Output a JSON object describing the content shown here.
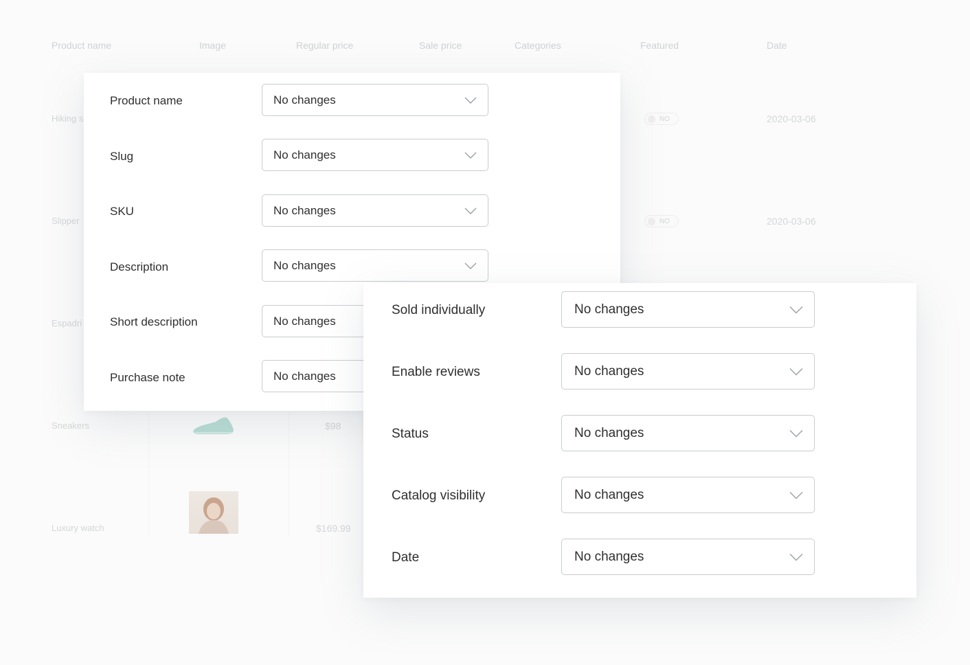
{
  "background_table": {
    "headers": [
      "Product name",
      "Image",
      "Regular price",
      "Sale price",
      "Categories",
      "Featured",
      "Date"
    ],
    "rows": [
      {
        "name": "Hiking s",
        "featured": "NO",
        "date": "2020-03-06"
      },
      {
        "name": "Slipper",
        "featured": "NO",
        "date": "2020-03-06"
      },
      {
        "name": "Espadri"
      },
      {
        "name": "Sneakers",
        "price": "$98"
      },
      {
        "name": "Luxury watch",
        "price": "$169.99"
      }
    ]
  },
  "panel_a": {
    "fields": [
      {
        "label": "Product name",
        "value": "No changes"
      },
      {
        "label": "Slug",
        "value": "No changes"
      },
      {
        "label": "SKU",
        "value": "No changes"
      },
      {
        "label": "Description",
        "value": "No changes"
      },
      {
        "label": "Short description",
        "value": "No changes"
      },
      {
        "label": "Purchase note",
        "value": "No changes"
      }
    ]
  },
  "panel_b": {
    "fields": [
      {
        "label": "Sold individually",
        "value": "No changes"
      },
      {
        "label": "Enable reviews",
        "value": "No changes"
      },
      {
        "label": "Status",
        "value": "No changes"
      },
      {
        "label": "Catalog visibility",
        "value": "No changes"
      },
      {
        "label": "Date",
        "value": "No changes"
      }
    ]
  },
  "icons": {
    "dropdown": "chevron-down-icon"
  },
  "colors": {
    "border": "#c9cbcd",
    "text": "#2f2f2f",
    "faded": "#d4d6d8"
  }
}
